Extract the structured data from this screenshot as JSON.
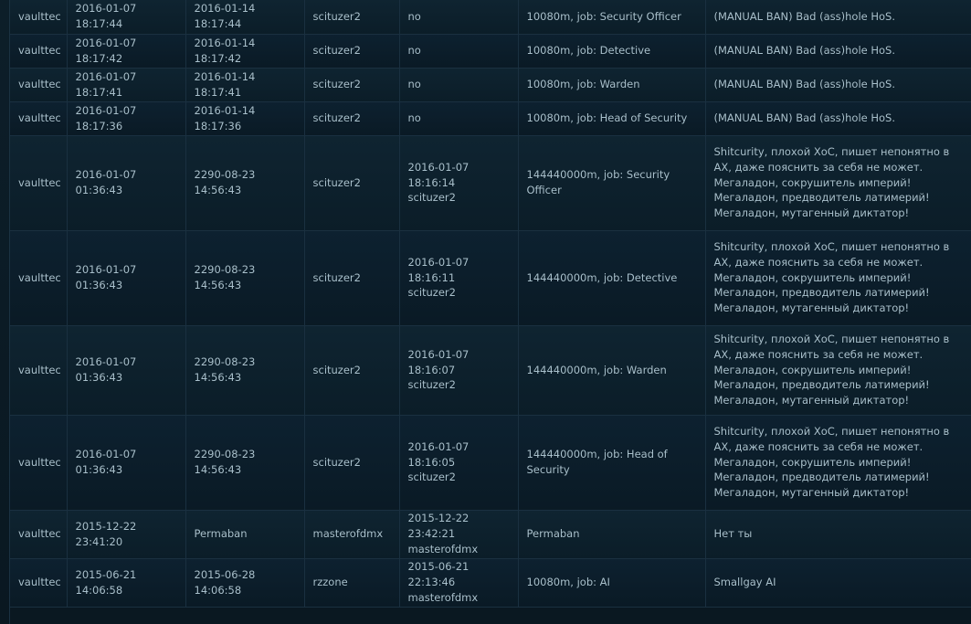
{
  "rows": [
    {
      "admin": "vaulttec",
      "time": "2016-01-07 18:17:44",
      "expires": "2016-01-14 18:17:44",
      "ckey": "scituzer2",
      "unbanned_time": "no",
      "unbanned_by": "",
      "duration_job": "10080m, job: Security Officer",
      "reason": "(MANUAL BAN) Bad (ass)hole HoS."
    },
    {
      "admin": "vaulttec",
      "time": "2016-01-07 18:17:42",
      "expires": "2016-01-14 18:17:42",
      "ckey": "scituzer2",
      "unbanned_time": "no",
      "unbanned_by": "",
      "duration_job": "10080m, job: Detective",
      "reason": "(MANUAL BAN) Bad (ass)hole HoS."
    },
    {
      "admin": "vaulttec",
      "time": "2016-01-07 18:17:41",
      "expires": "2016-01-14 18:17:41",
      "ckey": "scituzer2",
      "unbanned_time": "no",
      "unbanned_by": "",
      "duration_job": "10080m, job: Warden",
      "reason": "(MANUAL BAN) Bad (ass)hole HoS."
    },
    {
      "admin": "vaulttec",
      "time": "2016-01-07 18:17:36",
      "expires": "2016-01-14 18:17:36",
      "ckey": "scituzer2",
      "unbanned_time": "no",
      "unbanned_by": "",
      "duration_job": "10080m, job: Head of Security",
      "reason": "(MANUAL BAN) Bad (ass)hole HoS."
    },
    {
      "admin": "vaulttec",
      "time": "2016-01-07 01:36:43",
      "expires": "2290-08-23 14:56:43",
      "ckey": "scituzer2",
      "unbanned_time": "2016-01-07 18:16:14",
      "unbanned_by": "scituzer2",
      "duration_job": "144440000m, job: Security Officer",
      "reason": "Shitcurity, плохой ХоС, пишет непонятно в АХ, даже пояснить за себя не может. Мегаладон, сокрушитель империй! Мегаладон, предводитель латимерий! Мегаладон, мутагенный диктатор!"
    },
    {
      "admin": "vaulttec",
      "time": "2016-01-07 01:36:43",
      "expires": "2290-08-23 14:56:43",
      "ckey": "scituzer2",
      "unbanned_time": "2016-01-07 18:16:11",
      "unbanned_by": "scituzer2",
      "duration_job": "144440000m, job: Detective",
      "reason": "Shitcurity, плохой ХоС, пишет непонятно в АХ, даже пояснить за себя не может. Мегаладон, сокрушитель империй! Мегаладон, предводитель латимерий! Мегаладон, мутагенный диктатор!"
    },
    {
      "admin": "vaulttec",
      "time": "2016-01-07 01:36:43",
      "expires": "2290-08-23 14:56:43",
      "ckey": "scituzer2",
      "unbanned_time": "2016-01-07 18:16:07",
      "unbanned_by": "scituzer2",
      "duration_job": "144440000m, job: Warden",
      "reason": "Shitcurity, плохой ХоС, пишет непонятно в АХ, даже пояснить за себя не может. Мегаладон, сокрушитель империй! Мегаладон, предводитель латимерий! Мегаладон, мутагенный диктатор!"
    },
    {
      "admin": "vaulttec",
      "time": "2016-01-07 01:36:43",
      "expires": "2290-08-23 14:56:43",
      "ckey": "scituzer2",
      "unbanned_time": "2016-01-07 18:16:05",
      "unbanned_by": "scituzer2",
      "duration_job": "144440000m, job: Head of Security",
      "reason": "Shitcurity, плохой ХоС, пишет непонятно в АХ, даже пояснить за себя не может. Мегаладон, сокрушитель империй! Мегаладон, предводитель латимерий! Мегаладон, мутагенный диктатор!"
    },
    {
      "admin": "vaulttec",
      "time": "2015-12-22 23:41:20",
      "expires": "Permaban",
      "ckey": "masterofdmx",
      "unbanned_time": "2015-12-22 23:42:21",
      "unbanned_by": "masterofdmx",
      "duration_job": "Permaban",
      "reason": "Нет ты"
    },
    {
      "admin": "vaulttec",
      "time": "2015-06-21 14:06:58",
      "expires": "2015-06-28 14:06:58",
      "ckey": "rzzone",
      "unbanned_time": "2015-06-21 22:13:46",
      "unbanned_by": "masterofdmx",
      "duration_job": "10080m, job: AI",
      "reason": "Smallgay AI"
    }
  ]
}
